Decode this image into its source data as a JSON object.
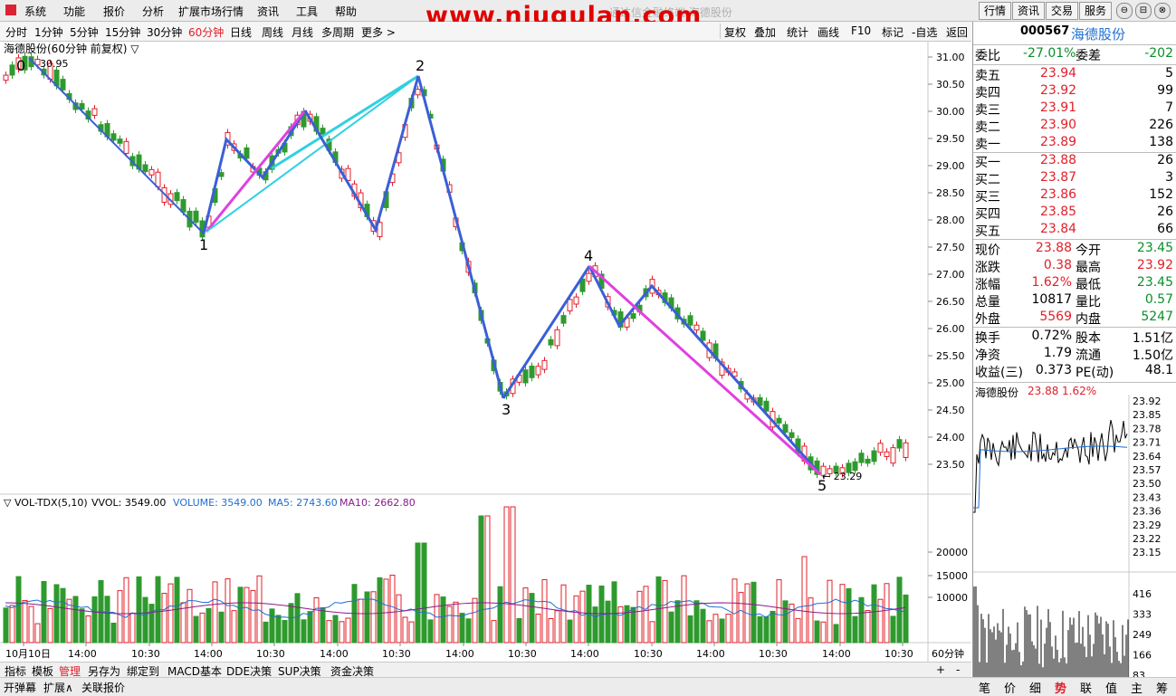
{
  "menu": {
    "items": [
      "系统",
      "功能",
      "报价",
      "分析",
      "扩展市场行情",
      "资讯",
      "工具",
      "帮助"
    ]
  },
  "watermark": "www.niugulan.com",
  "window_title": "通达信金融终端 海德股份",
  "top_right_buttons": [
    "行情",
    "资讯",
    "交易",
    "服务"
  ],
  "window_controls": [
    "⊖",
    "⊟",
    "⊗"
  ],
  "period_bar": {
    "items": [
      "分时",
      "1分钟",
      "5分钟",
      "15分钟",
      "30分钟",
      "60分钟",
      "日线",
      "周线",
      "月线",
      "多周期",
      "更多 >"
    ],
    "active": "60分钟",
    "tools": [
      "复权",
      "叠加",
      "统计",
      "画线",
      "F10",
      "标记",
      "-自选",
      "返回"
    ]
  },
  "chart": {
    "title": "海德股份(60分钟 前复权) ▽",
    "high_label": "30.95",
    "low_label": "← 23.29",
    "wave_labels": [
      "0",
      "1",
      "2",
      "3",
      "4",
      "5"
    ],
    "y_ticks": [
      "31.00",
      "30.50",
      "30.00",
      "29.50",
      "29.00",
      "28.50",
      "28.00",
      "27.50",
      "27.00",
      "26.50",
      "26.00",
      "25.50",
      "25.00",
      "24.50",
      "24.00",
      "23.50"
    ]
  },
  "volume": {
    "header_prefix": "▽ VOL-TDX(5,10)",
    "vvol": "VVOL: 3549.00",
    "volume": "VOLUME: 3549.00",
    "ma5": "MA5: 2743.60",
    "ma10": "MA10: 2662.80",
    "y_ticks": [
      "20000",
      "15000",
      "10000"
    ],
    "colors": {
      "up": "#e0202a",
      "down": "#2e9a2e",
      "volume_line": "#1f6fd1",
      "ma5": "#1f6fd1",
      "ma10": "#8b1a8b"
    }
  },
  "time_axis": [
    "10月10日",
    "14:00",
    "10:30",
    "14:00",
    "10:30",
    "14:00",
    "10:30",
    "14:00",
    "10:30",
    "14:00",
    "10:30",
    "14:00",
    "10:30",
    "14:00",
    "10:30"
  ],
  "period_label": "60分钟",
  "indicator_tabs": [
    "指标",
    "模板",
    "管理",
    "另存为",
    "绑定到",
    "MACD基本",
    "DDE决策",
    "SUP决策",
    "资金决策"
  ],
  "indicator_active": "管理",
  "zoom": [
    "+",
    "-"
  ],
  "status_bar": [
    "开弹幕",
    "扩展∧",
    "关联报价"
  ],
  "quote": {
    "code": "000567",
    "name": "海德股份",
    "weibi_label": "委比",
    "weibi": "-27.01%",
    "weicha_label": "委差",
    "weicha": "-202",
    "asks": [
      {
        "label": "卖五",
        "price": "23.94",
        "vol": "5"
      },
      {
        "label": "卖四",
        "price": "23.92",
        "vol": "99"
      },
      {
        "label": "卖三",
        "price": "23.91",
        "vol": "7"
      },
      {
        "label": "卖二",
        "price": "23.90",
        "vol": "226"
      },
      {
        "label": "卖一",
        "price": "23.89",
        "vol": "138"
      }
    ],
    "bids": [
      {
        "label": "买一",
        "price": "23.88",
        "vol": "26"
      },
      {
        "label": "买二",
        "price": "23.87",
        "vol": "3"
      },
      {
        "label": "买三",
        "price": "23.86",
        "vol": "152"
      },
      {
        "label": "买四",
        "price": "23.85",
        "vol": "26"
      },
      {
        "label": "买五",
        "price": "23.84",
        "vol": "66"
      }
    ],
    "stats": [
      {
        "l1": "现价",
        "v1": "23.88",
        "c1": "red",
        "l2": "今开",
        "v2": "23.45",
        "c2": "green"
      },
      {
        "l1": "涨跌",
        "v1": "0.38",
        "c1": "red",
        "l2": "最高",
        "v2": "23.92",
        "c2": "red"
      },
      {
        "l1": "涨幅",
        "v1": "1.62%",
        "c1": "red",
        "l2": "最低",
        "v2": "23.45",
        "c2": "green"
      },
      {
        "l1": "总量",
        "v1": "10817",
        "c1": "black",
        "l2": "量比",
        "v2": "0.57",
        "c2": "green"
      },
      {
        "l1": "外盘",
        "v1": "5569",
        "c1": "red",
        "l2": "内盘",
        "v2": "5247",
        "c2": "green"
      }
    ],
    "stats2": [
      {
        "l1": "换手",
        "v1": "0.72%",
        "l2": "股本",
        "v2": "1.51亿"
      },
      {
        "l1": "净资",
        "v1": "1.79",
        "l2": "流通",
        "v2": "1.50亿"
      },
      {
        "l1": "收益(三)",
        "v1": "0.373",
        "l2": "PE(动)",
        "v2": "48.1"
      }
    ]
  },
  "mini": {
    "title": "海德股份",
    "price": "23.88",
    "pct": "1.62%",
    "price_ticks": [
      "23.92",
      "23.85",
      "23.78",
      "23.71",
      "23.64",
      "23.57",
      "23.50",
      "23.43",
      "23.36",
      "23.29",
      "23.22",
      "23.15"
    ],
    "vol_ticks": [
      "416",
      "333",
      "249",
      "166",
      "83"
    ]
  },
  "bottom_tabs": [
    "笔",
    "价",
    "细",
    "势",
    "联",
    "值",
    "主",
    "筹"
  ],
  "bottom_tab_active": "势"
}
